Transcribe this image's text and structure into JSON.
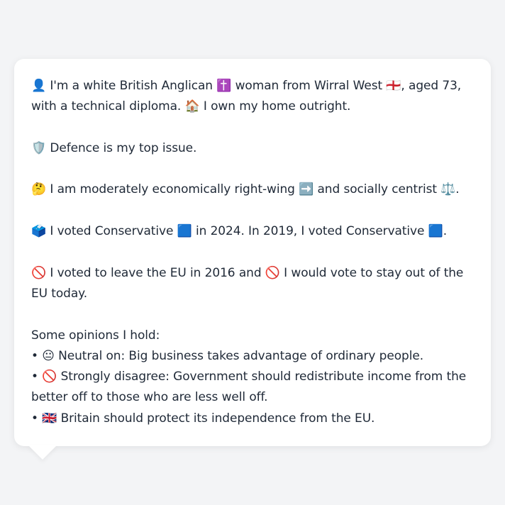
{
  "profile": {
    "line1": "👤 I'm a white British Anglican ✝️ woman from Wirral West 🏴󠁧󠁢󠁥󠁮󠁧󠁿, aged 73, with a technical diploma. 🏠 I own my home outright.",
    "line2": "🛡️ Defence is my top issue.",
    "line3": "🤔 I am moderately economically right-wing ➡️ and socially centrist ⚖️.",
    "line4": "🗳️ I voted Conservative 🟦 in 2024. In 2019, I voted Conservative 🟦.",
    "line5": "🚫 I voted to leave the EU in 2016 and 🚫 I would vote to stay out of the EU today."
  },
  "opinions": {
    "heading": "Some opinions I hold:",
    "items": [
      "• 😐 Neutral on: Big business takes advantage of ordinary people.",
      "• 🚫 Strongly disagree: Government should redistribute income from the better off to those who are less well off.",
      "• 🇬🇧 Britain should protect its independence from the EU."
    ]
  }
}
